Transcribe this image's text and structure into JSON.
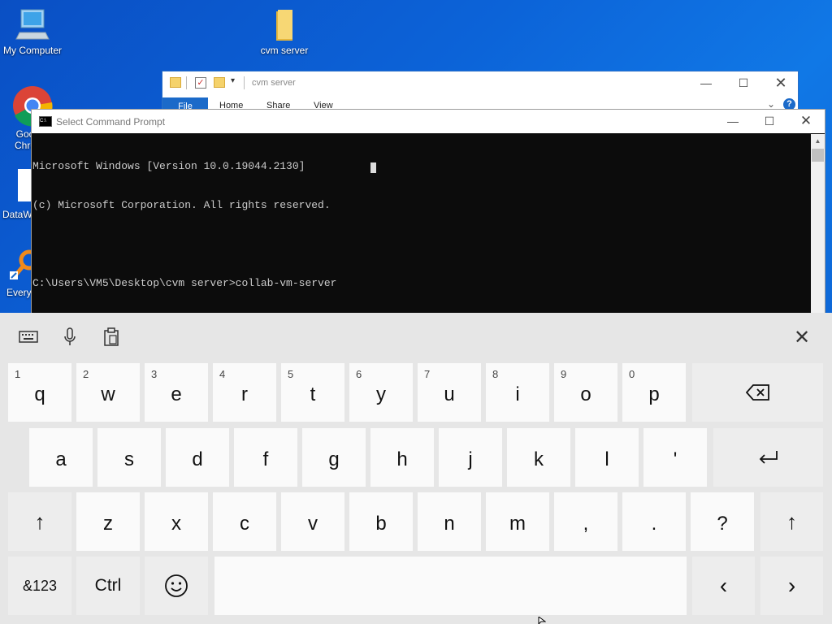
{
  "desktop": {
    "icons": [
      {
        "label": "My Computer"
      },
      {
        "label": "cvm server"
      },
      {
        "label": "Goo Chro"
      },
      {
        "label": "DataW"
      },
      {
        "label": "Every"
      }
    ]
  },
  "explorer": {
    "title": "cvm server",
    "tabs": [
      "File",
      "Home",
      "Share",
      "View"
    ]
  },
  "cmd": {
    "title": "Select Command Prompt",
    "lines": [
      "Microsoft Windows [Version 10.0.19044.2130]",
      "(c) Microsoft Corporation. All rights reserved.",
      "",
      "C:\\Users\\VM5\\Desktop\\cvm server>collab-vm-server"
    ]
  },
  "keyboard": {
    "row1": [
      {
        "num": "1",
        "ch": "q"
      },
      {
        "num": "2",
        "ch": "w"
      },
      {
        "num": "3",
        "ch": "e"
      },
      {
        "num": "4",
        "ch": "r"
      },
      {
        "num": "5",
        "ch": "t"
      },
      {
        "num": "6",
        "ch": "y"
      },
      {
        "num": "7",
        "ch": "u"
      },
      {
        "num": "8",
        "ch": "i"
      },
      {
        "num": "9",
        "ch": "o"
      },
      {
        "num": "0",
        "ch": "p"
      }
    ],
    "row2": [
      "a",
      "s",
      "d",
      "f",
      "g",
      "h",
      "j",
      "k",
      "l",
      "'"
    ],
    "row3": [
      "z",
      "x",
      "c",
      "v",
      "b",
      "n",
      "m",
      ",",
      ".",
      "?"
    ],
    "numbers_label": "&123",
    "ctrl_label": "Ctrl"
  },
  "colors": {
    "accent": "#1b6ac9",
    "console_bg": "#0c0c0c",
    "keyboard_bg": "#e6e6e6"
  }
}
